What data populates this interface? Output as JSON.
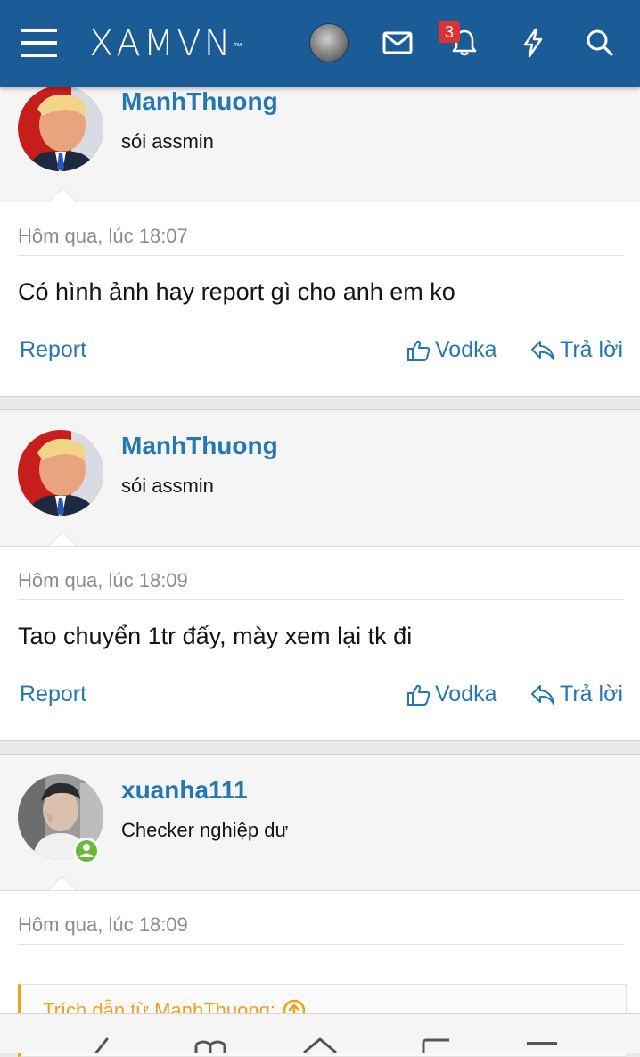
{
  "header": {
    "logo_text": "XAMVN",
    "logo_tm": "™",
    "notification_count": "3",
    "brand_color": "#1c5c96"
  },
  "posts": [
    {
      "username": "ManhThuong",
      "user_title": "sói assmin",
      "date": "Hôm qua, lúc 18:07",
      "message": "Có hình ảnh hay report gì cho anh em ko",
      "report_label": "Report",
      "like_label": "Vodka",
      "reply_label": "Trả lời"
    },
    {
      "username": "ManhThuong",
      "user_title": "sói assmin",
      "date": "Hôm qua, lúc 18:09",
      "message": "Tao chuyển 1tr đấy, mày xem lại tk đi",
      "report_label": "Report",
      "like_label": "Vodka",
      "reply_label": "Trả lời"
    },
    {
      "username": "xuanha111",
      "user_title": "Checker nghiệp dư",
      "date": "Hôm qua, lúc 18:09",
      "quote_label": "Trích dẫn từ ManhThuong:"
    }
  ],
  "colors": {
    "link": "#2577b1",
    "quote_accent": "#f0a01a",
    "online": "#6cb83b",
    "badge": "#e03131"
  }
}
